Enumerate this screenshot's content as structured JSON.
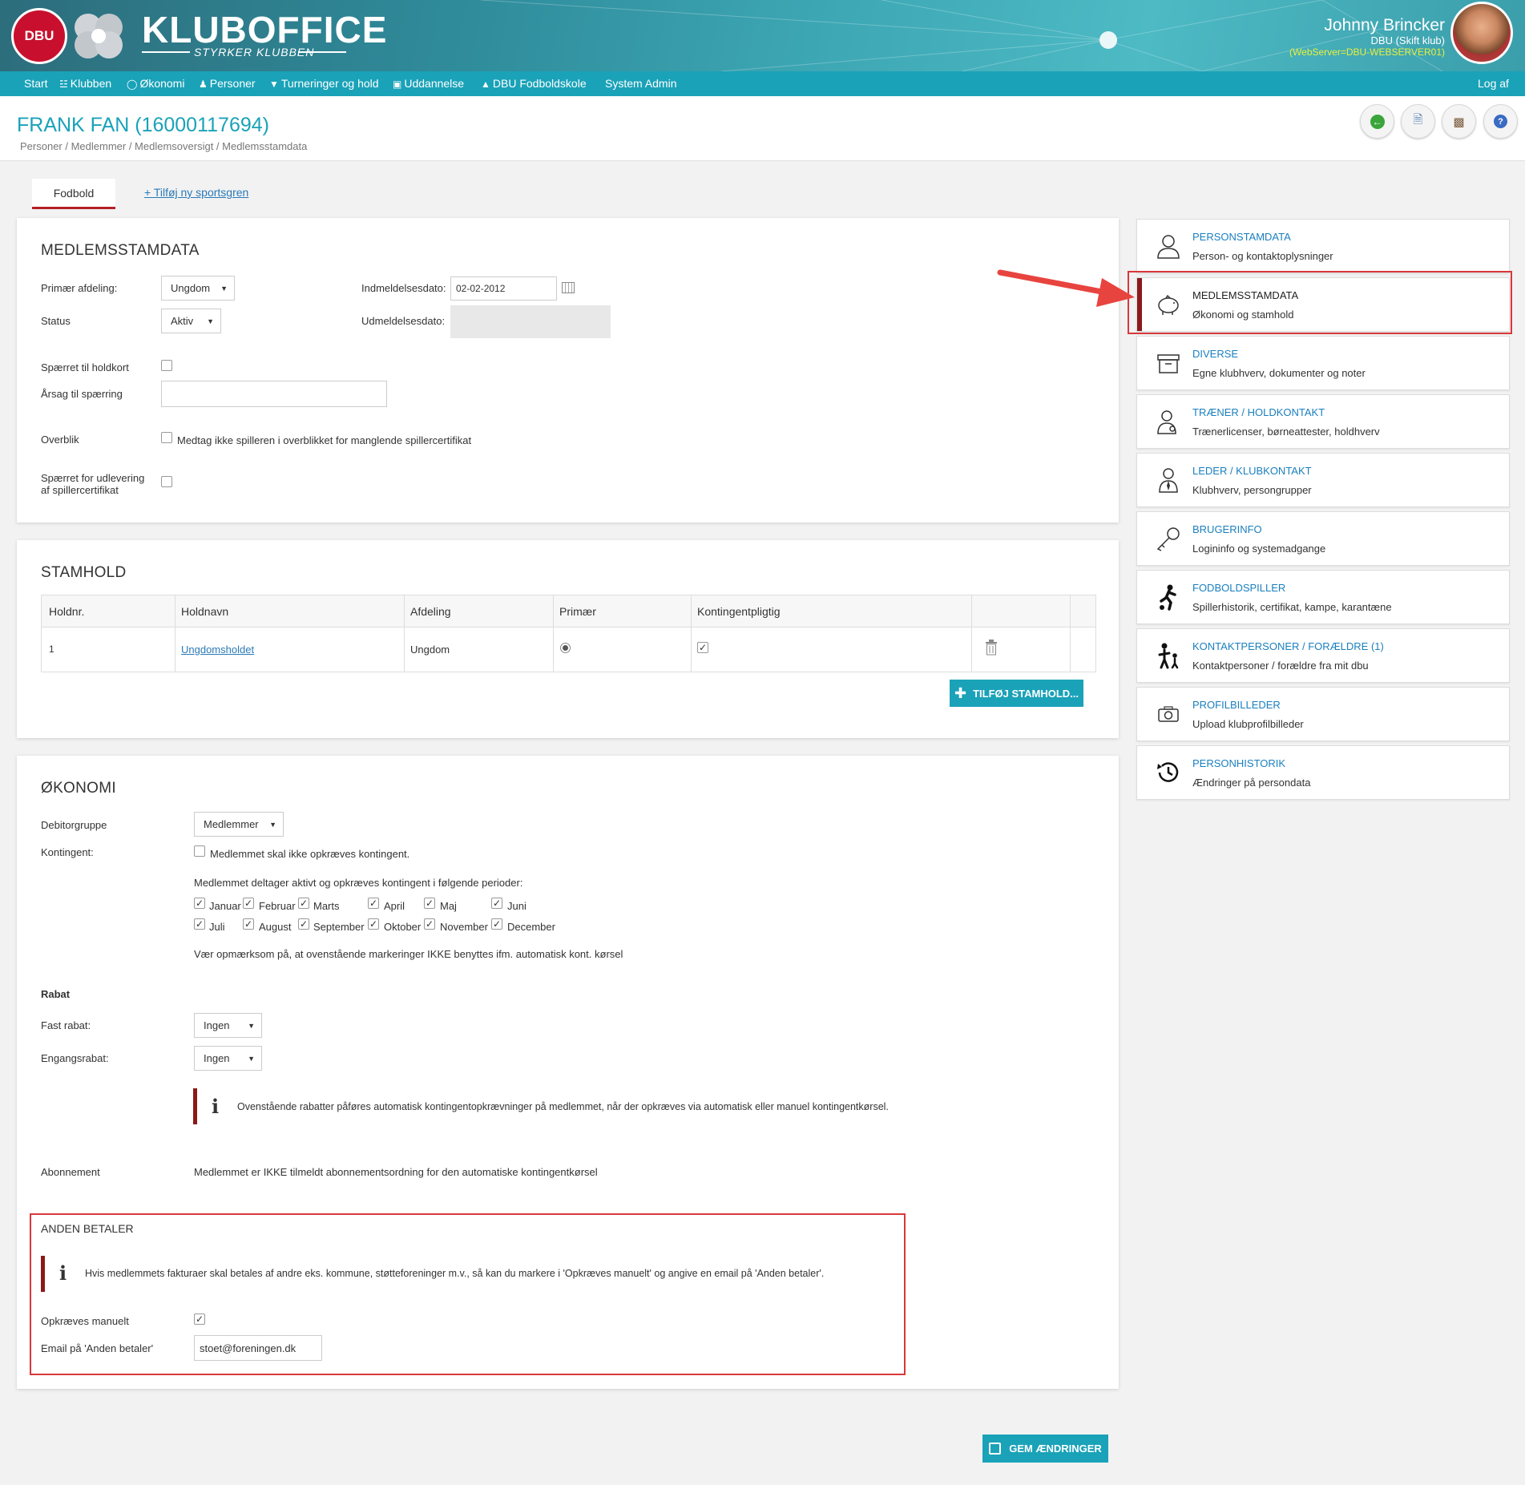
{
  "header": {
    "logo_text": "DBU",
    "brand": "KLUBOFFICE",
    "tagline": "STYRKER KLUBBEN",
    "user_name": "Johnny Brincker",
    "user_club": "DBU (Skift klub)",
    "user_server": "(WebServer=DBU-WEBSERVER01)"
  },
  "nav": {
    "items": [
      "Start",
      "Klubben",
      "Økonomi",
      "Personer",
      "Turneringer og hold",
      "Uddannelse",
      "DBU Fodboldskole",
      "System Admin"
    ],
    "logout": "Log af"
  },
  "page": {
    "title": "FRANK FAN (16000117694)",
    "breadcrumb": "Personer / Medlemmer / Medlemsoversigt / Medlemsstamdata"
  },
  "tabs": {
    "active": "Fodbold",
    "add": "+ Tilføj ny sportsgren"
  },
  "medlem": {
    "heading": "MEDLEMSSTAMDATA",
    "primary_label": "Primær afdeling:",
    "primary_value": "Ungdom",
    "status_label": "Status",
    "status_value": "Aktiv",
    "join_label": "Indmeldelsesdato:",
    "join_value": "02-02-2012",
    "leave_label": "Udmeldelsesdato:",
    "block_label": "Spærret til holdkort",
    "reason_label": "Årsag til spærring",
    "overview_label": "Overblik",
    "overview_text": "Medtag ikke spilleren i overblikket for manglende spillercertifikat",
    "cert_label_1": "Spærret for udlevering",
    "cert_label_2": "af spillercertifikat"
  },
  "stamhold": {
    "heading": "STAMHOLD",
    "columns": [
      "Holdnr.",
      "Holdnavn",
      "Afdeling",
      "Primær",
      "Kontingentpligtig"
    ],
    "rows": [
      {
        "nr": "1",
        "name": "Ungdomsholdet",
        "dept": "Ungdom",
        "primary": true,
        "due": true
      }
    ],
    "add_button": "TILFØJ STAMHOLD..."
  },
  "okonomi": {
    "heading": "ØKONOMI",
    "debitor_label": "Debitorgruppe",
    "debitor_value": "Medlemmer",
    "kontingent_label": "Kontingent:",
    "kontingent_text": "Medlemmet skal ikke opkræves kontingent.",
    "periods_text": "Medlemmet deltager aktivt og opkræves kontingent i følgende perioder:",
    "months": [
      "Januar",
      "Februar",
      "Marts",
      "April",
      "Maj",
      "Juni",
      "Juli",
      "August",
      "September",
      "Oktober",
      "November",
      "December"
    ],
    "notice": "Vær opmærksom på, at ovenstående markeringer IKKE benyttes ifm. automatisk kont. kørsel",
    "rabat_heading": "Rabat",
    "fast_label": "Fast rabat:",
    "fast_value": "Ingen",
    "engang_label": "Engangsrabat:",
    "engang_value": "Ingen",
    "rabat_info": "Ovenstående rabatter påføres automatisk kontingentopkrævninger på medlemmet, når der opkræves via automatisk eller manuel kontingentkørsel.",
    "abonnement_label": "Abonnement",
    "abonnement_text": "Medlemmet er IKKE tilmeldt abonnementsordning for den automatiske kontingentkørsel"
  },
  "anden": {
    "heading": "ANDEN BETALER",
    "info": "Hvis medlemmets fakturaer skal betales af andre eks. kommune, støtteforeninger m.v., så kan du markere i 'Opkræves manuelt' og angive en email på 'Anden betaler'.",
    "manual_label": "Opkræves manuelt",
    "email_label": "Email på 'Anden betaler'",
    "email_value": "stoet@foreningen.dk"
  },
  "save_button": "GEM ÆNDRINGER",
  "sidebar": [
    {
      "title": "PERSONSTAMDATA",
      "sub": "Person- og kontaktoplysninger",
      "icon": "person-icon"
    },
    {
      "title": "MEDLEMSSTAMDATA",
      "sub": "Økonomi og stamhold",
      "icon": "piggy-bank-icon"
    },
    {
      "title": "DIVERSE",
      "sub": "Egne klubhverv, dokumenter og noter",
      "icon": "archive-box-icon"
    },
    {
      "title": "TRÆNER / HOLDKONTAKT",
      "sub": "Trænerlicenser, børneattester, holdhverv",
      "icon": "coach-icon"
    },
    {
      "title": "LEDER / KLUBKONTAKT",
      "sub": "Klubhverv, persongrupper",
      "icon": "leader-icon"
    },
    {
      "title": "BRUGERINFO",
      "sub": "Logininfo og systemadgange",
      "icon": "key-icon"
    },
    {
      "title": "FODBOLDSPILLER",
      "sub": "Spillerhistorik, certifikat, kampe, karantæne",
      "icon": "football-player-icon"
    },
    {
      "title": "KONTAKTPERSONER / FORÆLDRE (1)",
      "sub": "Kontaktpersoner / forældre fra mit dbu",
      "icon": "parent-child-icon"
    },
    {
      "title": "PROFILBILLEDER",
      "sub": "Upload klubprofilbilleder",
      "icon": "camera-icon"
    },
    {
      "title": "PERSONHISTORIK",
      "sub": "Ændringer på persondata",
      "icon": "history-icon"
    }
  ],
  "colors": {
    "accent": "#1aa2b8",
    "highlight_red": "#d9383a",
    "dark_red": "#8a1a1a"
  }
}
